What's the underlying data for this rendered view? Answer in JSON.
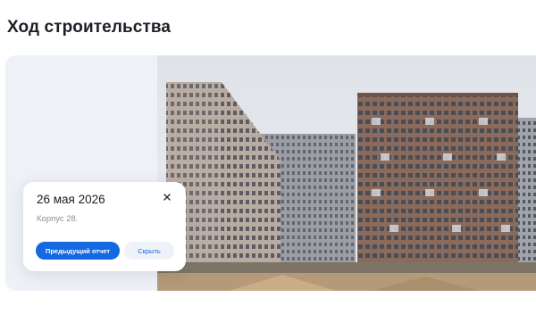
{
  "page": {
    "title": "Ход строительства"
  },
  "colors": {
    "accent": "#1468e0",
    "card_background": "#eef1f7",
    "muted_text": "#8a8f9a"
  },
  "photo": {
    "subject": "construction-site-photo"
  },
  "popup": {
    "date": "26 мая 2026",
    "subtitle": "Корпус 28.",
    "close_icon": "close-icon",
    "prev_report_label": "Предыдущий отчет",
    "hide_label": "Скрыть"
  }
}
